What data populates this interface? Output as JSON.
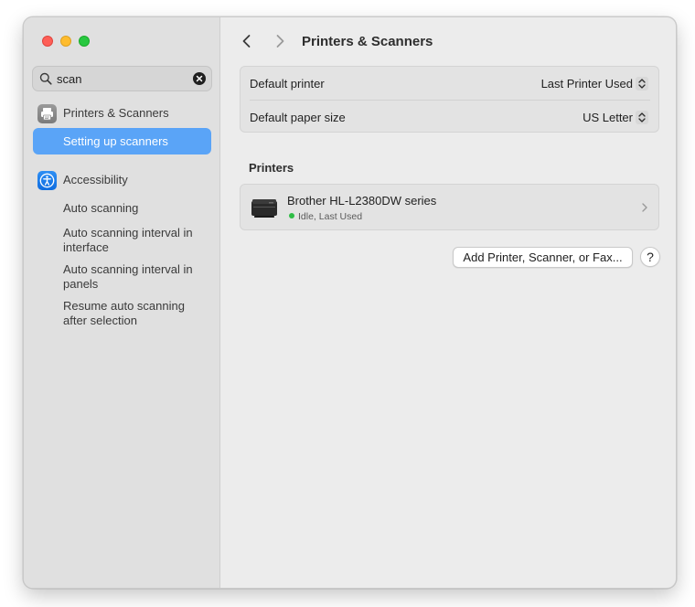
{
  "window": {
    "title": "Printers & Scanners"
  },
  "traffic_lights": {
    "close_color": "#fe5f57",
    "minimize_color": "#febc2e",
    "zoom_color": "#28c840"
  },
  "search": {
    "value": "scan",
    "icon": "magnifying-glass-icon",
    "clear_icon": "clear-circle-icon"
  },
  "sidebar": {
    "selected_color": "#5aa4f7",
    "groups": [
      {
        "label": "Printers & Scanners",
        "icon": "printer-icon",
        "items": [
          {
            "label": "Setting up scanners",
            "selected": true
          }
        ]
      },
      {
        "label": "Accessibility",
        "icon": "accessibility-icon",
        "items": [
          {
            "label": "Auto scanning",
            "selected": false
          },
          {
            "label": "Auto scanning interval in interface",
            "selected": false
          },
          {
            "label": "Auto scanning interval in panels",
            "selected": false
          },
          {
            "label": "Resume auto scanning after selection",
            "selected": false
          }
        ]
      }
    ]
  },
  "nav": {
    "back_icon": "chevron-left-icon",
    "forward_icon": "chevron-right-icon"
  },
  "settings": {
    "default_printer": {
      "label": "Default printer",
      "value": "Last Printer Used"
    },
    "default_paper_size": {
      "label": "Default paper size",
      "value": "US Letter"
    }
  },
  "printers": {
    "heading": "Printers",
    "list": [
      {
        "name": "Brother HL-L2380DW series",
        "status": "Idle, Last Used",
        "status_color": "#2ebd45"
      }
    ]
  },
  "actions": {
    "add_label": "Add Printer, Scanner, or Fax...",
    "help_label": "?"
  }
}
